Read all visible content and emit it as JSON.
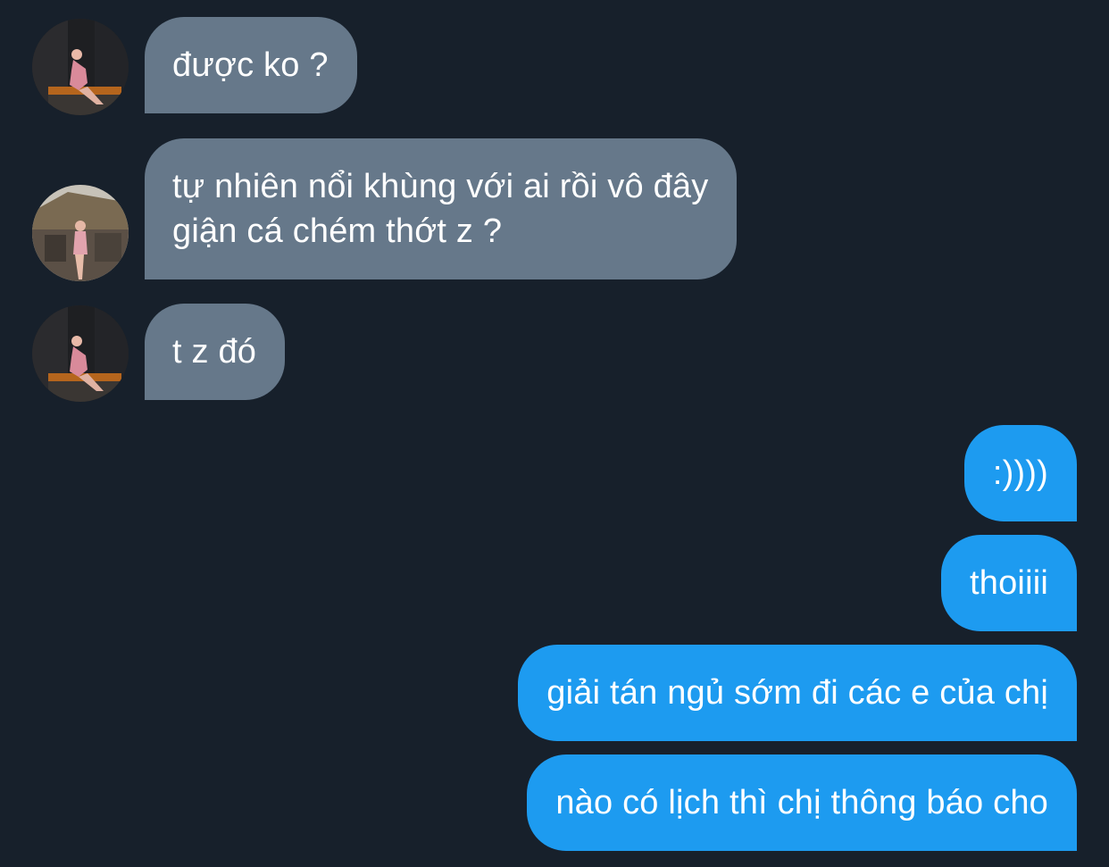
{
  "conversation": {
    "incoming": [
      {
        "text": "được ko ?",
        "avatar": "contact-avatar"
      },
      {
        "text": "tự nhiên nổi khùng với ai rồi vô đây\ngiận cá chém thớt z ?",
        "avatar": "contact-avatar"
      },
      {
        "text": "t z đó",
        "avatar": "contact-avatar"
      }
    ],
    "outgoing": [
      {
        "text": ":))))"
      },
      {
        "text": "thoiiii"
      },
      {
        "text": "giải tán ngủ sớm đi các e của chị"
      },
      {
        "text": "nào có lịch thì chị thông báo cho"
      }
    ]
  },
  "colors": {
    "background": "#17202b",
    "incoming_bubble": "#66788a",
    "outgoing_bubble": "#1d9bf0",
    "text": "#ffffff"
  }
}
